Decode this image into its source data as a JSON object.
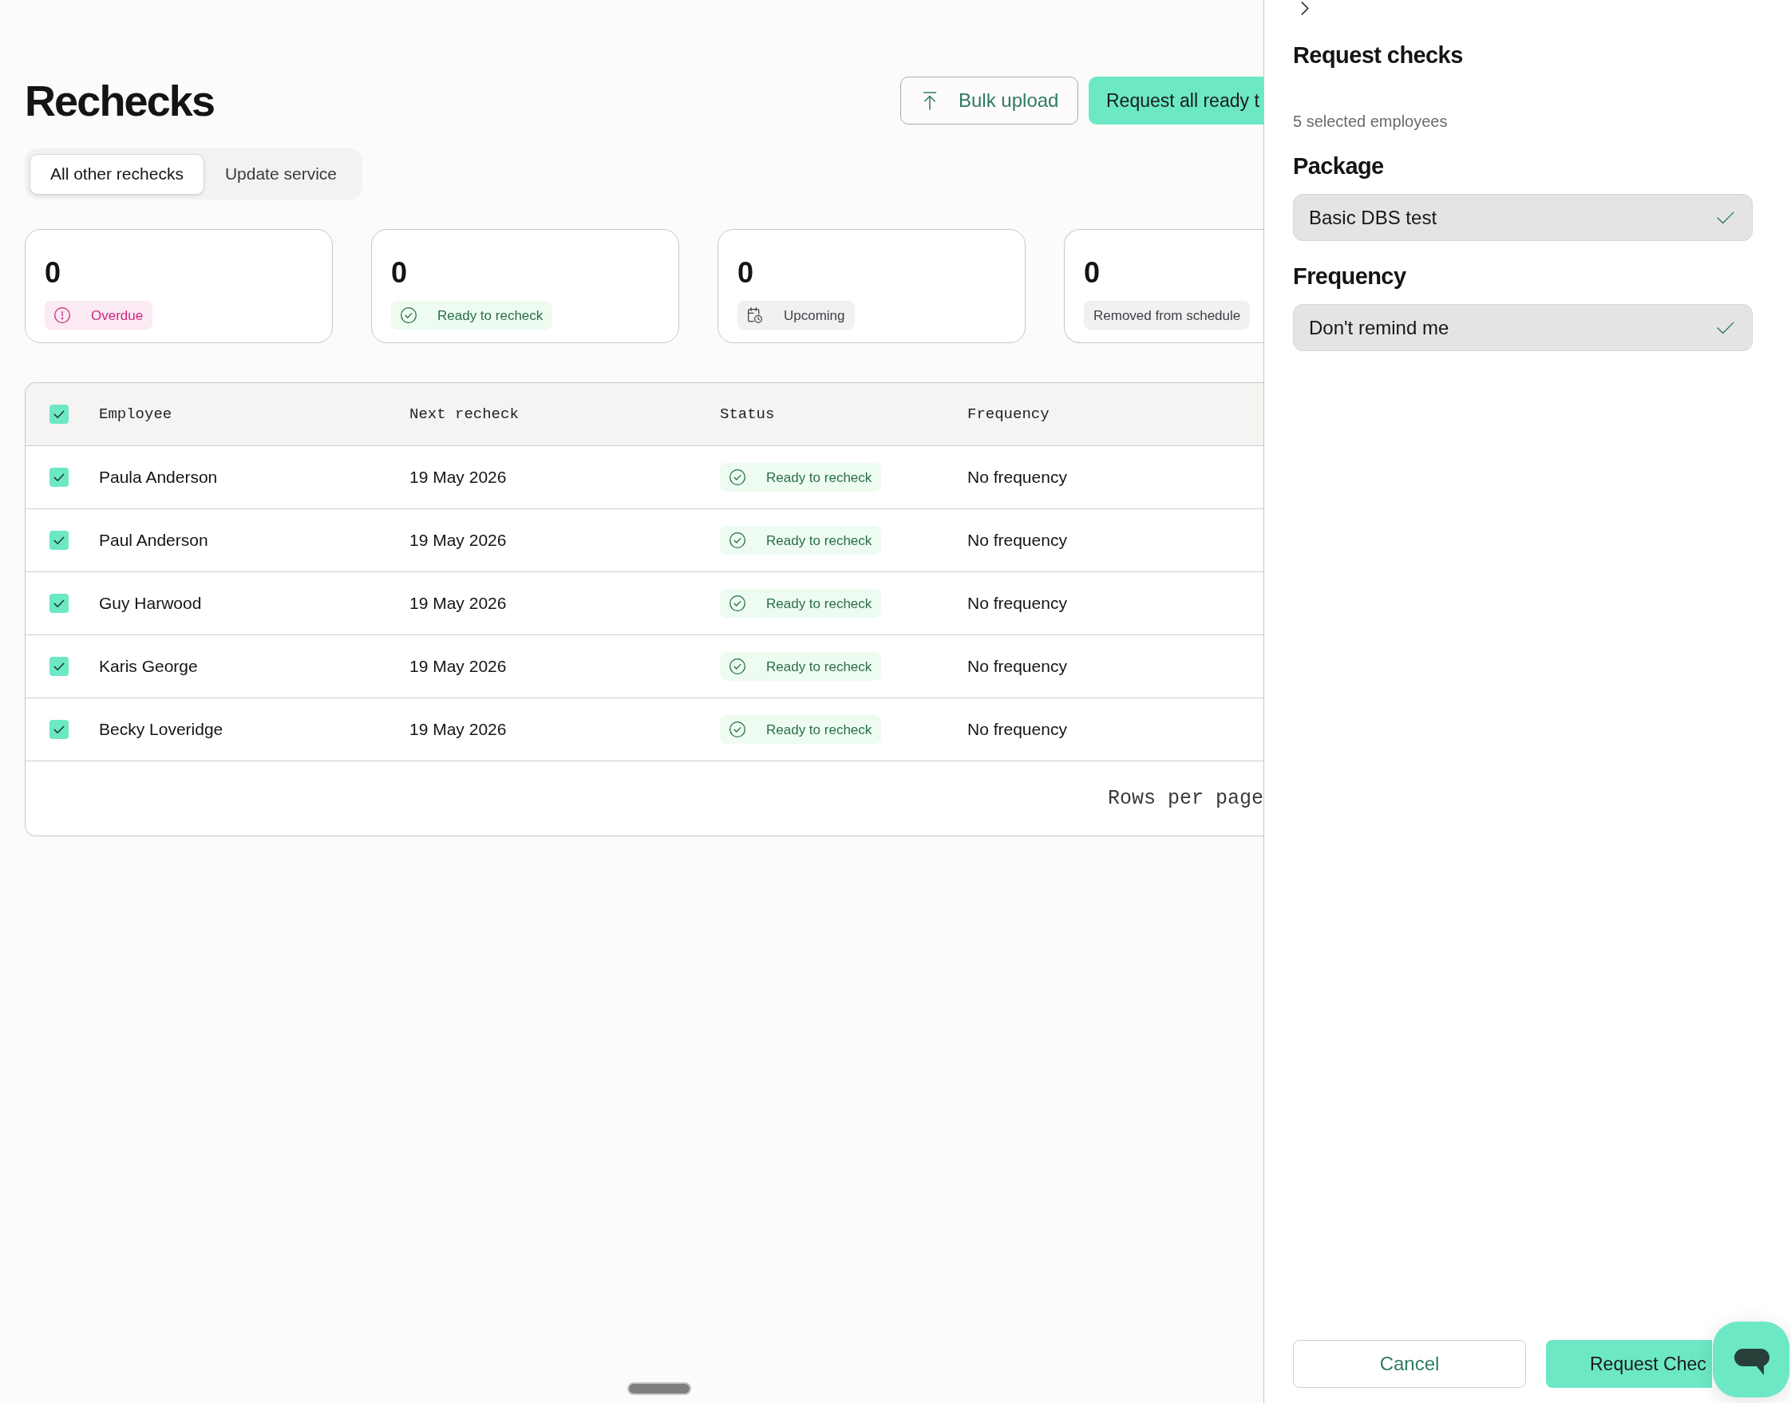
{
  "page": {
    "title": "Rechecks"
  },
  "header_actions": [
    {
      "label": "Bulk upload",
      "kind": "upload"
    },
    {
      "label": "Request all ready t",
      "kind": "request"
    }
  ],
  "tabs": [
    {
      "label": "All other rechecks",
      "selected": true
    },
    {
      "label": "Update service",
      "selected": false
    }
  ],
  "summary_cards": [
    {
      "count": "0",
      "label": "Overdue",
      "kind": "overdue"
    },
    {
      "count": "0",
      "label": "Ready to recheck",
      "kind": "ready"
    },
    {
      "count": "0",
      "label": "Upcoming",
      "kind": "upcoming"
    },
    {
      "count": "0",
      "label": "Removed from schedule",
      "kind": "removed"
    }
  ],
  "table": {
    "select_all": {
      "checked": true
    },
    "columns": [
      "Employee",
      "Next recheck",
      "Status",
      "Frequency"
    ],
    "rows": [
      {
        "checked": true,
        "employee": "Paula Anderson",
        "next_recheck": "19 May 2026",
        "status": {
          "label": "Ready to recheck",
          "kind": "ready"
        },
        "frequency": "No frequency"
      },
      {
        "checked": true,
        "employee": "Paul Anderson",
        "next_recheck": "19 May 2026",
        "status": {
          "label": "Ready to recheck",
          "kind": "ready"
        },
        "frequency": "No frequency"
      },
      {
        "checked": true,
        "employee": "Guy Harwood",
        "next_recheck": "19 May 2026",
        "status": {
          "label": "Ready to recheck",
          "kind": "ready"
        },
        "frequency": "No frequency"
      },
      {
        "checked": true,
        "employee": "Karis George",
        "next_recheck": "19 May 2026",
        "status": {
          "label": "Ready to recheck",
          "kind": "ready"
        },
        "frequency": "No frequency"
      },
      {
        "checked": true,
        "employee": "Becky Loveridge",
        "next_recheck": "19 May 2026",
        "status": {
          "label": "Ready to recheck",
          "kind": "ready"
        },
        "frequency": "No frequency"
      }
    ],
    "footer": "Rows per page"
  },
  "panel": {
    "title": "Request checks",
    "subtitle": "5 selected employees",
    "fields": [
      {
        "label": "Package",
        "value": "Basic DBS test"
      },
      {
        "label": "Frequency",
        "value": "Don't remind me"
      }
    ],
    "buttons": [
      {
        "label": "Cancel",
        "kind": "cancel"
      },
      {
        "label": "Request Chec",
        "kind": "submit"
      }
    ]
  }
}
